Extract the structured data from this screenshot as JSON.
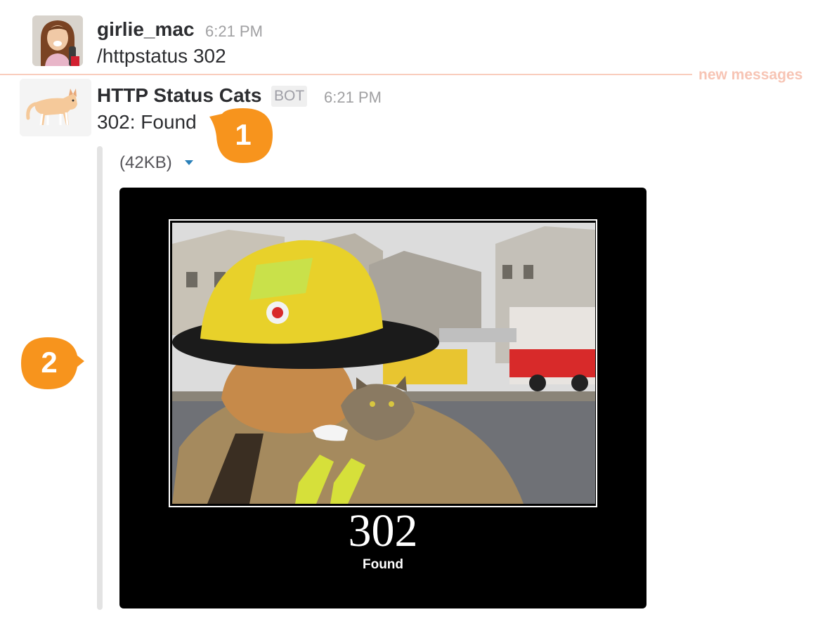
{
  "messages": [
    {
      "sender": "girlie_mac",
      "time": "6:21 PM",
      "text": "/httpstatus 302",
      "avatar": "user-avatar"
    },
    {
      "sender": "HTTP Status Cats",
      "badge": "BOT",
      "time": "6:21 PM",
      "text": "302: Found",
      "avatar": "cat-avatar",
      "attachment": {
        "size_label": "(42KB)",
        "caret_icon": "chevron-down-icon",
        "poster_code": "302",
        "poster_caption": "Found"
      }
    }
  ],
  "divider": {
    "label": "new messages"
  },
  "callouts": [
    {
      "number": "1"
    },
    {
      "number": "2"
    }
  ],
  "colors": {
    "callout": "#f7941d",
    "divider": "#f9cdbd",
    "divider_text": "#f7c4b4",
    "caret": "#2a80b9",
    "timestamp": "#a0a0a2",
    "badge_bg": "#efefef",
    "attachment_bar": "#e3e3e3"
  }
}
